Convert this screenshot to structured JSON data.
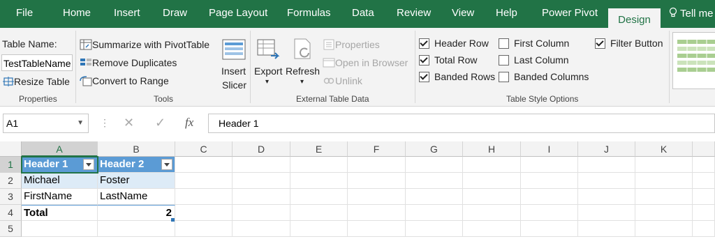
{
  "tabs": [
    "File",
    "Home",
    "Insert",
    "Draw",
    "Page Layout",
    "Formulas",
    "Data",
    "Review",
    "View",
    "Help",
    "Power Pivot"
  ],
  "active_tab": "Design",
  "tell_me": "Tell me",
  "properties": {
    "table_name_label": "Table Name:",
    "table_name_value": "TestTableName",
    "resize": "Resize Table",
    "group": "Properties"
  },
  "tools": {
    "summarize": "Summarize with PivotTable",
    "remove_dup": "Remove Duplicates",
    "convert": "Convert to Range",
    "insert_slicer_1": "Insert",
    "insert_slicer_2": "Slicer",
    "group": "Tools"
  },
  "external": {
    "export": "Export",
    "refresh": "Refresh",
    "properties": "Properties",
    "open_browser": "Open in Browser",
    "unlink": "Unlink",
    "group": "External Table Data"
  },
  "style_options": {
    "header_row": "Header Row",
    "total_row": "Total Row",
    "banded_rows": "Banded Rows",
    "first_column": "First Column",
    "last_column": "Last Column",
    "banded_columns": "Banded Columns",
    "filter_button": "Filter Button",
    "group": "Table Style Options",
    "checked": {
      "header_row": true,
      "total_row": true,
      "banded_rows": true,
      "first_column": false,
      "last_column": false,
      "banded_columns": false,
      "filter_button": true
    }
  },
  "formula_bar": {
    "name_box": "A1",
    "fx": "fx",
    "content": "Header 1"
  },
  "columns": [
    "A",
    "B",
    "C",
    "D",
    "E",
    "F",
    "G",
    "H",
    "I",
    "J",
    "K"
  ],
  "rows": [
    "1",
    "2",
    "3",
    "4",
    "5"
  ],
  "cells": {
    "a1": "Header 1",
    "b1": "Header 2",
    "a2": "Michael",
    "b2": "Foster",
    "a3": "FirstName",
    "b3": "LastName",
    "a4": "Total",
    "b4": "2"
  },
  "colors": {
    "ribbon_green": "#217346",
    "table_header": "#5b9bd5",
    "band": "#ddebf7"
  }
}
